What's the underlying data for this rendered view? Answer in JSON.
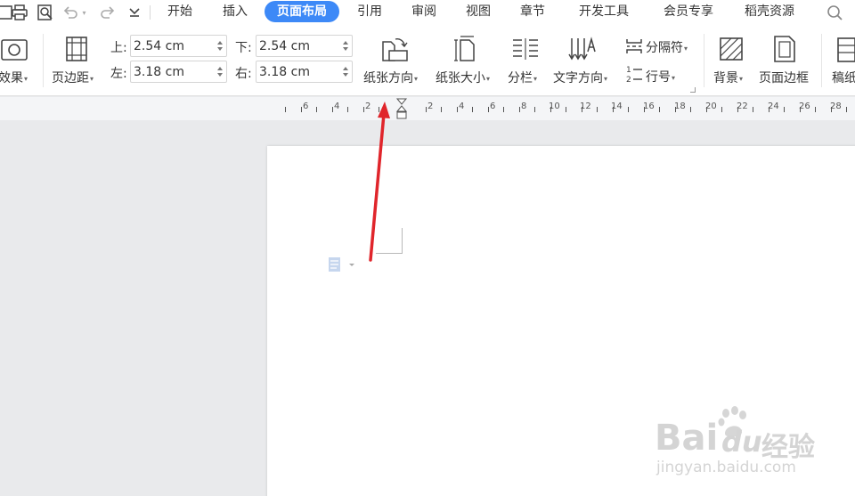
{
  "toolbar": {
    "quick_icons": [
      "save-icon",
      "print-icon",
      "print-preview-icon",
      "undo-icon",
      "redo-icon",
      "customize-icon"
    ],
    "tabs": [
      "开始",
      "插入",
      "页面布局",
      "引用",
      "审阅",
      "视图",
      "章节",
      "开发工具",
      "会员专享",
      "稻壳资源"
    ],
    "active_tab": "页面布局"
  },
  "ribbon": {
    "effects_label": "效果",
    "margins_label": "页边距",
    "margin_top_label": "上:",
    "margin_top_value": "2.54 cm",
    "margin_bottom_label": "下:",
    "margin_bottom_value": "2.54 cm",
    "margin_left_label": "左:",
    "margin_left_value": "3.18 cm",
    "margin_right_label": "右:",
    "margin_right_value": "3.18 cm",
    "orientation_label": "纸张方向",
    "size_label": "纸张大小",
    "columns_label": "分栏",
    "text_direction_label": "文字方向",
    "breaks_label": "分隔符",
    "line_numbers_label": "行号",
    "background_label": "背景",
    "page_border_label": "页面边框",
    "draft_label": "稿纸"
  },
  "ruler": {
    "numbers": [
      "6",
      "4",
      "2",
      "2",
      "4",
      "6",
      "8",
      "10",
      "12",
      "14",
      "16",
      "18",
      "20",
      "22",
      "24",
      "26",
      "28"
    ]
  },
  "watermark": {
    "brand": "Bai",
    "brand_suffix": "经验",
    "url": "jingyan.baidu.com"
  },
  "colors": {
    "accent": "#3d89f7",
    "annotation_arrow": "#e0252b"
  }
}
